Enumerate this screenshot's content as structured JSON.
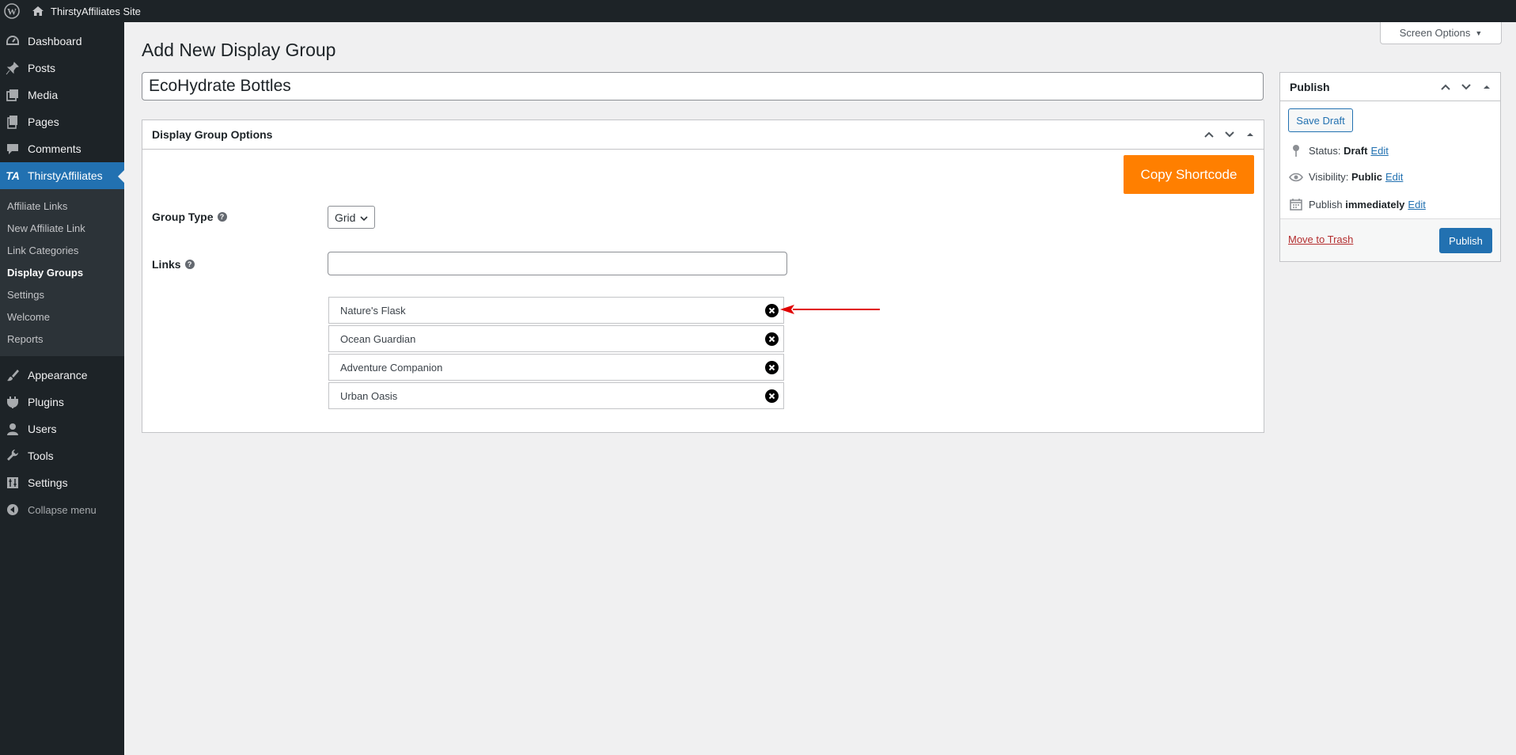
{
  "admin_bar": {
    "site_name": "ThirstyAffiliates Site"
  },
  "sidebar": {
    "items_top": [
      {
        "label": "Dashboard",
        "icon": "dashboard-icon"
      },
      {
        "label": "Posts",
        "icon": "pushpin-icon"
      },
      {
        "label": "Media",
        "icon": "media-icon"
      },
      {
        "label": "Pages",
        "icon": "pages-icon"
      },
      {
        "label": "Comments",
        "icon": "comments-icon"
      },
      {
        "label": "ThirstyAffiliates",
        "icon": "thirstyaffiliates-icon"
      }
    ],
    "submenu": [
      {
        "label": "Affiliate Links"
      },
      {
        "label": "New Affiliate Link"
      },
      {
        "label": "Link Categories"
      },
      {
        "label": "Display Groups"
      },
      {
        "label": "Settings"
      },
      {
        "label": "Welcome"
      },
      {
        "label": "Reports"
      }
    ],
    "items_bottom": [
      {
        "label": "Appearance",
        "icon": "paintbrush-icon"
      },
      {
        "label": "Plugins",
        "icon": "plugin-icon"
      },
      {
        "label": "Users",
        "icon": "users-icon"
      },
      {
        "label": "Tools",
        "icon": "wrench-icon"
      },
      {
        "label": "Settings",
        "icon": "settings-icon"
      }
    ],
    "collapse_label": "Collapse menu"
  },
  "screen_options": {
    "label": "Screen Options"
  },
  "page": {
    "title": "Add New Display Group",
    "post_title_value": "EcoHydrate Bottles"
  },
  "options_box": {
    "title": "Display Group Options",
    "copy_shortcode_label": "Copy Shortcode",
    "group_type_label": "Group Type",
    "group_type_value": "Grid",
    "links_label": "Links",
    "links_input_value": "",
    "links": [
      {
        "name": "Nature's Flask"
      },
      {
        "name": "Ocean Guardian"
      },
      {
        "name": "Adventure Companion"
      },
      {
        "name": "Urban Oasis"
      }
    ]
  },
  "publish_box": {
    "title": "Publish",
    "save_draft_label": "Save Draft",
    "status_label": "Status:",
    "status_value": "Draft",
    "visibility_label": "Visibility:",
    "visibility_value": "Public",
    "publish_label": "Publish",
    "publish_value": "immediately",
    "edit_label": "Edit",
    "trash_label": "Move to Trash",
    "publish_button_label": "Publish"
  },
  "colors": {
    "accent": "#2271b1",
    "copy_shortcode": "#ff7f00",
    "annotation_arrow": "#e00000",
    "trash": "#b32d2e"
  }
}
